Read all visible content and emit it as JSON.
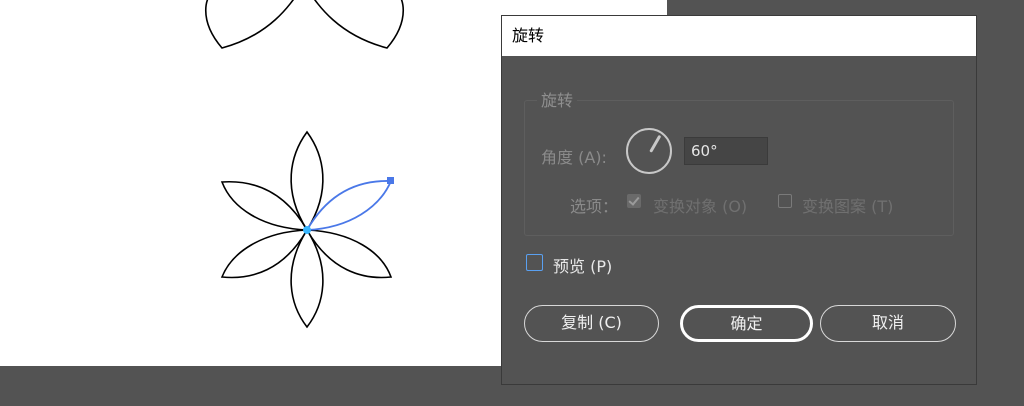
{
  "dialog": {
    "title": "旋转",
    "group_legend": "旋转",
    "angle_label": "角度 (A):",
    "angle_value": "60°",
    "options_label": "选项：",
    "transform_objects": {
      "label": "变换对象 (O)",
      "checked": true,
      "enabled": false
    },
    "transform_patterns": {
      "label": "变换图案 (T)",
      "checked": false,
      "enabled": false
    },
    "preview": {
      "label": "预览 (P)",
      "checked": false
    },
    "buttons": {
      "copy": "复制 (C)",
      "ok": "确定",
      "cancel": "取消"
    }
  },
  "canvas": {
    "selection_color": "#4a78e8",
    "anchor_color": "#37b6ff"
  }
}
